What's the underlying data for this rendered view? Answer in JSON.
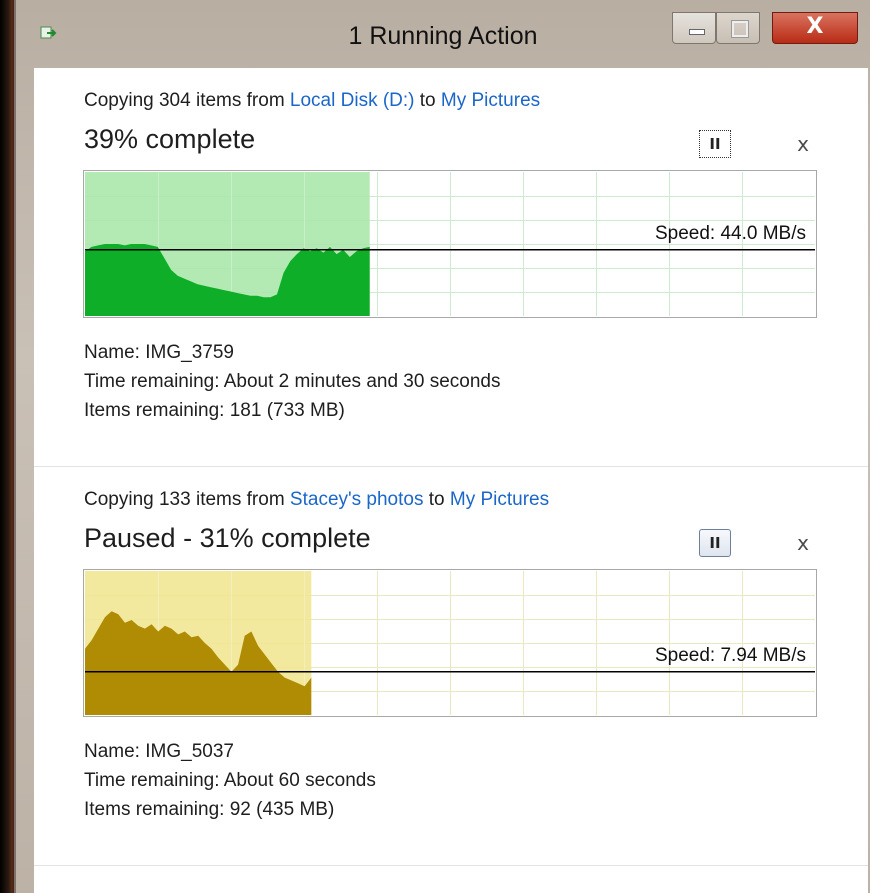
{
  "window": {
    "title": "1 Running Action",
    "close_glyph": "X",
    "colors": {
      "close": "#c7361f",
      "link": "#1b66c9"
    }
  },
  "operations": [
    {
      "header_prefix": "Copying 304 items from ",
      "source": "Local Disk (D:)",
      "header_mid": " to ",
      "destination": "My Pictures",
      "status": "39% complete",
      "progress": 0.39,
      "speed_text": "Speed: 44.0 MB/s",
      "speed_level": 0.46,
      "pause_glyph": "II",
      "cancel_glyph": "x",
      "name_text": "Name:  IMG_3759",
      "time_text": "Time remaining:  About 2 minutes and 30 seconds",
      "items_text": "Items remaining:  181 (733 MB)",
      "theme": {
        "fill": "#0fae28",
        "band": "#a6e6a6",
        "grid": "#cdebd3"
      },
      "speed_history": [
        0.45,
        0.48,
        0.49,
        0.5,
        0.5,
        0.5,
        0.49,
        0.5,
        0.5,
        0.5,
        0.49,
        0.48,
        0.4,
        0.32,
        0.28,
        0.26,
        0.24,
        0.22,
        0.21,
        0.2,
        0.19,
        0.18,
        0.17,
        0.16,
        0.15,
        0.14,
        0.14,
        0.13,
        0.13,
        0.15,
        0.3,
        0.38,
        0.43,
        0.47,
        0.45,
        0.47,
        0.44,
        0.48,
        0.43,
        0.46,
        0.41,
        0.45,
        0.47,
        0.48
      ]
    },
    {
      "header_prefix": "Copying 133 items from ",
      "source": "Stacey's photos",
      "header_mid": " to ",
      "destination": "My Pictures",
      "status": "Paused - 31% complete",
      "progress": 0.31,
      "speed_text": "Speed: 7.94 MB/s",
      "speed_level": 0.3,
      "pause_glyph": "II",
      "cancel_glyph": "x",
      "name_text": "Name:  IMG_5037",
      "time_text": "Time remaining:  About 60 seconds",
      "items_text": "Items remaining:  92 (435 MB)",
      "theme": {
        "fill": "#b08c05",
        "band": "#f0e58e",
        "grid": "#ece7c3"
      },
      "speed_history": [
        0.46,
        0.52,
        0.6,
        0.68,
        0.72,
        0.7,
        0.64,
        0.66,
        0.62,
        0.6,
        0.63,
        0.58,
        0.62,
        0.6,
        0.56,
        0.58,
        0.54,
        0.55,
        0.5,
        0.46,
        0.4,
        0.35,
        0.3,
        0.35,
        0.55,
        0.58,
        0.48,
        0.42,
        0.36,
        0.3,
        0.26,
        0.24,
        0.22,
        0.2,
        0.26
      ]
    }
  ]
}
